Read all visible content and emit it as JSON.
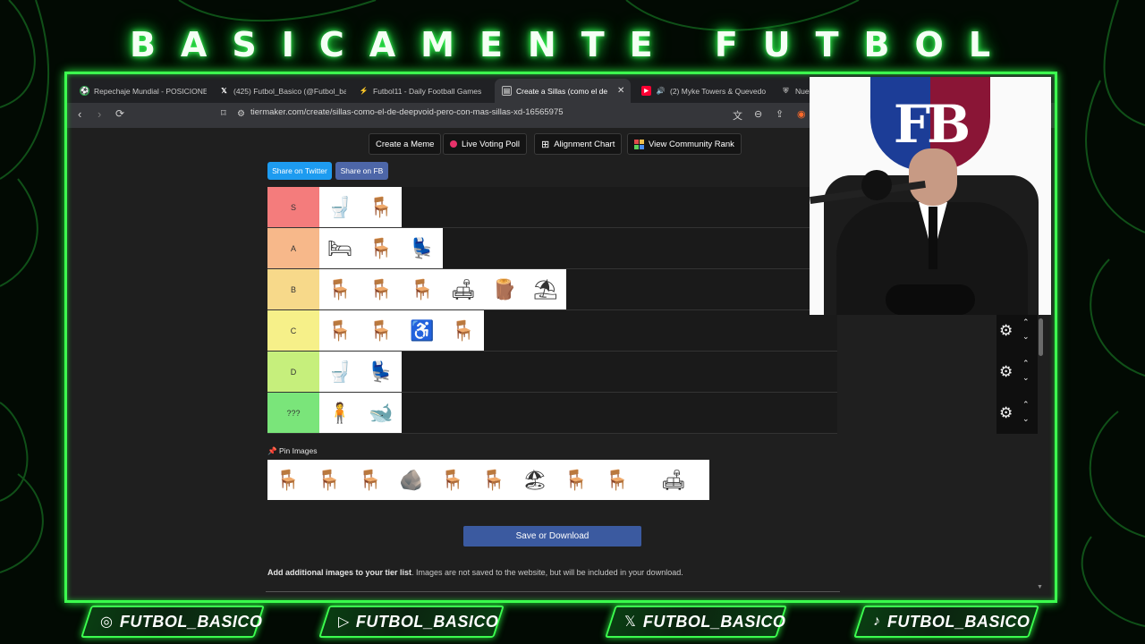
{
  "brand": {
    "title": "BASICAMENTE FUTBOL"
  },
  "tabs": [
    {
      "label": "Repechaje Mundial - POSICIONES",
      "icon": "soccer-icon",
      "color": "#2aa84a"
    },
    {
      "label": "(425) Futbol_Basico (@Futbol_ba",
      "icon": "x-logo-icon",
      "color": "#000000"
    },
    {
      "label": "Futbol11 - Daily Football Games",
      "icon": "futbol11-icon",
      "color": "#1d4fd8"
    },
    {
      "label": "Create a Sillas (como el de",
      "icon": "tiermaker-icon",
      "color": "#3a3a3a",
      "active": true
    },
    {
      "label": "(2) Myke Towers & Quevedo",
      "icon": "youtube-icon",
      "color": "#ff0033"
    },
    {
      "label": "Nue",
      "icon": "shield-icon",
      "color": "#777777"
    }
  ],
  "toolbar": {
    "url": "tiermaker.com/create/sillas-como-el-de-deepvoid-pero-con-mas-sillas-xd-16565975"
  },
  "page": {
    "buttons": {
      "create_meme": "Create a Meme",
      "live_voting": "Live Voting Poll",
      "alignment": "Alignment Chart",
      "community": "View Community Rank"
    },
    "share_twitter": "Share on Twitter",
    "share_fb": "Share on FB",
    "tiers": [
      {
        "label": "S",
        "color": "#f47c7c",
        "items": [
          "🚽",
          "🪑"
        ]
      },
      {
        "label": "A",
        "color": "#f7b88a",
        "items": [
          "🛏",
          "🪑",
          "💺"
        ]
      },
      {
        "label": "B",
        "color": "#f7d98a",
        "items": [
          "🪑",
          "🪑",
          "🪑",
          "🛋",
          "🪵",
          "⛱"
        ]
      },
      {
        "label": "C",
        "color": "#f6f089",
        "items": [
          "🪑",
          "🪑",
          "♿",
          "🪑"
        ]
      },
      {
        "label": "D",
        "color": "#c6ef7c",
        "items": [
          "🚽",
          "💺"
        ]
      },
      {
        "label": "???",
        "color": "#7ae57a",
        "items": [
          "🧍",
          "🐋"
        ]
      }
    ],
    "pin_label": "Pin Images",
    "pool_items": [
      "🪑",
      "🪑",
      "🪑",
      "🪨",
      "🪑",
      "🪑",
      "🏖",
      "🪑",
      "🪑",
      "🛋"
    ],
    "save_label": "Save or Download",
    "add_text_bold": "Add additional images to your tier list",
    "add_text_rest": ". Images are not saved to the website, but will be included in your download."
  },
  "webcam": {
    "crest_text": "FB"
  },
  "social": [
    {
      "handle": "FUTBOL_BASICO",
      "icon": "instagram-icon"
    },
    {
      "handle": "FUTBOL_BASICO",
      "icon": "youtube-icon"
    },
    {
      "handle": "FUTBOL_BASICO",
      "icon": "x-logo-icon"
    },
    {
      "handle": "FUTBOL_BASICO",
      "icon": "tiktok-icon"
    }
  ]
}
